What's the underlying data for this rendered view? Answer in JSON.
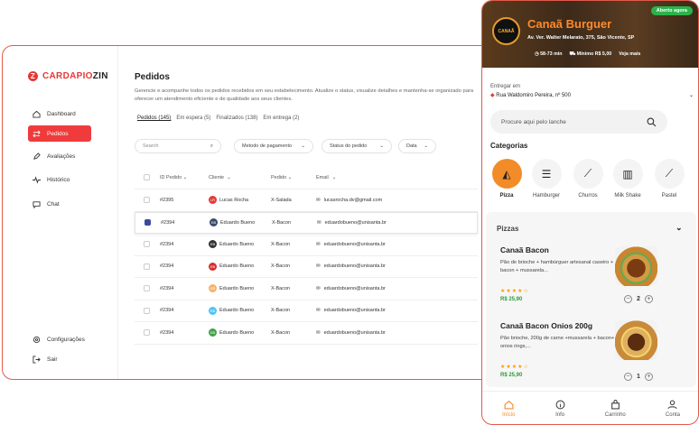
{
  "brand": {
    "name_a": "CARDAPIO",
    "name_b": "ZIN",
    "mark": "Z"
  },
  "sidebar": {
    "items": [
      {
        "label": "Dashboard",
        "icon": "home-icon"
      },
      {
        "label": "Pedidos",
        "icon": "swap-icon",
        "active": true
      },
      {
        "label": "Avaliações",
        "icon": "pencil-icon"
      },
      {
        "label": "Histórico",
        "icon": "pulse-icon"
      },
      {
        "label": "Chat",
        "icon": "chat-icon"
      }
    ],
    "footer": [
      {
        "label": "Configurações",
        "icon": "gear-icon"
      },
      {
        "label": "Sair",
        "icon": "logout-icon"
      }
    ]
  },
  "page": {
    "title": "Pedidos",
    "subtitle": "Gerencie e acompanhe todos os pedidos recebidos em seu estabelecimento. Atualize o status, visualize detalhes e mantenha-se organizado para oferecer um atendimento eficiente e de qualidade aos seus clientes.",
    "tabs": [
      "Pedidos (145)",
      "Em espera (5)",
      "Finalizados (138)",
      "Em entrega (2)"
    ]
  },
  "filters": {
    "search_placeholder": "Search",
    "payment": "Metodo de pagamento",
    "status": "Status do pedido",
    "date": "Data"
  },
  "table": {
    "headers": [
      "ID Pedido",
      "Cliente",
      "Pedido",
      "Email"
    ],
    "rows": [
      {
        "id": "#2395",
        "client": "Lucas Rocha",
        "initials": "LR",
        "color": "#e53935",
        "order": "X-Salada",
        "email": "lucasrocha.dv@gmail.com",
        "checked": false
      },
      {
        "id": "#2394",
        "client": "Eduardo Bueno",
        "initials": "EB",
        "color": "#3b4a6c",
        "order": "X-Bacon",
        "email": "eduardobueno@unisanta.br",
        "checked": true
      },
      {
        "id": "#2394",
        "client": "Eduardo Bueno",
        "initials": "EB",
        "color": "#333333",
        "order": "X-Bacon",
        "email": "eduardobueno@unisanta.br",
        "checked": false
      },
      {
        "id": "#2394",
        "client": "Eduardo Bueno",
        "initials": "EB",
        "color": "#d32f2f",
        "order": "X-Bacon",
        "email": "eduardobueno@unisanta.br",
        "checked": false
      },
      {
        "id": "#2394",
        "client": "Eduardo Bueno",
        "initials": "EB",
        "color": "#f6b26b",
        "order": "X-Bacon",
        "email": "eduardobueno@unisanta.br",
        "checked": false
      },
      {
        "id": "#2394",
        "client": "Eduardo Bueno",
        "initials": "EB",
        "color": "#4fc3f7",
        "order": "X-Bacon",
        "email": "eduardobueno@unisanta.br",
        "checked": false
      },
      {
        "id": "#2394",
        "client": "Eduardo Bueno",
        "initials": "EB",
        "color": "#43a047",
        "order": "X-Bacon",
        "email": "eduardobueno@unisanta.br",
        "checked": false
      }
    ]
  },
  "app": {
    "badge": "Aberto agora",
    "logo_text": "CANAÃ",
    "restaurant": "Canaã Burguer",
    "address": "Av. Ver. Walter Melarato, 375, São Vicente, SP",
    "time": "58-73 min",
    "minimum": "Mínimo R$ 5,00",
    "more": "Veja mais",
    "deliver_label": "Entregar em",
    "deliver_address": "Rua Waldomiro Pereira, nº 500",
    "search_placeholder": "Procure aqui pelo lanche",
    "categories_title": "Categorias",
    "categories": [
      "Pizza",
      "Hamburger",
      "Churros",
      "Milk Shake",
      "Pastel"
    ],
    "section": "Pizzas",
    "items": [
      {
        "name": "Canaã Bacon",
        "desc": "Pão de brioche + hambúrguer artesanal caseiro + bacon + mussarela...",
        "stars": "★★★★☆",
        "price": "R$ 25,90",
        "qty": "2"
      },
      {
        "name": "Canaã Bacon Onios 200g",
        "desc": "Pão brioche, 200g de carne +mussarela + bacon+ 3 onios rings,...",
        "stars": "★★★★☆",
        "price": "R$ 25,90",
        "qty": "1"
      }
    ],
    "bottom_nav": [
      "Início",
      "Info",
      "Carrinho",
      "Conta"
    ],
    "accent": "#f28c28",
    "brand_red": "#e53935"
  }
}
